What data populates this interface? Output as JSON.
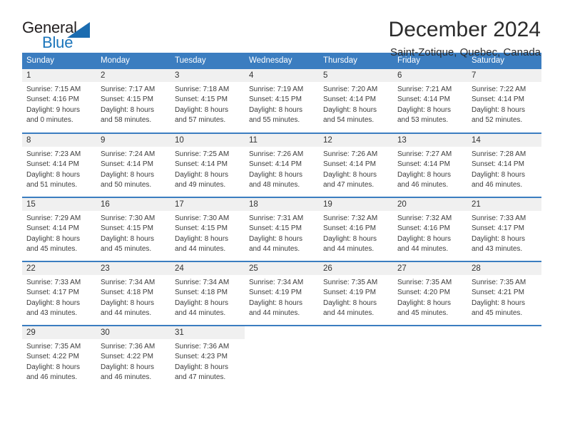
{
  "brand": {
    "name_top": "General",
    "name_bottom": "Blue",
    "accent_color": "#1b75bb",
    "triangle_color": "#1b6cb0"
  },
  "header": {
    "title": "December 2024",
    "location": "Saint-Zotique, Quebec, Canada"
  },
  "calendar": {
    "header_bg": "#3b7dc0",
    "daynum_bg": "#f0f0f0",
    "weekdays": [
      "Sunday",
      "Monday",
      "Tuesday",
      "Wednesday",
      "Thursday",
      "Friday",
      "Saturday"
    ],
    "weeks": [
      [
        {
          "day": "1",
          "sunrise": "Sunrise: 7:15 AM",
          "sunset": "Sunset: 4:16 PM",
          "daylight_1": "Daylight: 9 hours",
          "daylight_2": "and 0 minutes."
        },
        {
          "day": "2",
          "sunrise": "Sunrise: 7:17 AM",
          "sunset": "Sunset: 4:15 PM",
          "daylight_1": "Daylight: 8 hours",
          "daylight_2": "and 58 minutes."
        },
        {
          "day": "3",
          "sunrise": "Sunrise: 7:18 AM",
          "sunset": "Sunset: 4:15 PM",
          "daylight_1": "Daylight: 8 hours",
          "daylight_2": "and 57 minutes."
        },
        {
          "day": "4",
          "sunrise": "Sunrise: 7:19 AM",
          "sunset": "Sunset: 4:15 PM",
          "daylight_1": "Daylight: 8 hours",
          "daylight_2": "and 55 minutes."
        },
        {
          "day": "5",
          "sunrise": "Sunrise: 7:20 AM",
          "sunset": "Sunset: 4:14 PM",
          "daylight_1": "Daylight: 8 hours",
          "daylight_2": "and 54 minutes."
        },
        {
          "day": "6",
          "sunrise": "Sunrise: 7:21 AM",
          "sunset": "Sunset: 4:14 PM",
          "daylight_1": "Daylight: 8 hours",
          "daylight_2": "and 53 minutes."
        },
        {
          "day": "7",
          "sunrise": "Sunrise: 7:22 AM",
          "sunset": "Sunset: 4:14 PM",
          "daylight_1": "Daylight: 8 hours",
          "daylight_2": "and 52 minutes."
        }
      ],
      [
        {
          "day": "8",
          "sunrise": "Sunrise: 7:23 AM",
          "sunset": "Sunset: 4:14 PM",
          "daylight_1": "Daylight: 8 hours",
          "daylight_2": "and 51 minutes."
        },
        {
          "day": "9",
          "sunrise": "Sunrise: 7:24 AM",
          "sunset": "Sunset: 4:14 PM",
          "daylight_1": "Daylight: 8 hours",
          "daylight_2": "and 50 minutes."
        },
        {
          "day": "10",
          "sunrise": "Sunrise: 7:25 AM",
          "sunset": "Sunset: 4:14 PM",
          "daylight_1": "Daylight: 8 hours",
          "daylight_2": "and 49 minutes."
        },
        {
          "day": "11",
          "sunrise": "Sunrise: 7:26 AM",
          "sunset": "Sunset: 4:14 PM",
          "daylight_1": "Daylight: 8 hours",
          "daylight_2": "and 48 minutes."
        },
        {
          "day": "12",
          "sunrise": "Sunrise: 7:26 AM",
          "sunset": "Sunset: 4:14 PM",
          "daylight_1": "Daylight: 8 hours",
          "daylight_2": "and 47 minutes."
        },
        {
          "day": "13",
          "sunrise": "Sunrise: 7:27 AM",
          "sunset": "Sunset: 4:14 PM",
          "daylight_1": "Daylight: 8 hours",
          "daylight_2": "and 46 minutes."
        },
        {
          "day": "14",
          "sunrise": "Sunrise: 7:28 AM",
          "sunset": "Sunset: 4:14 PM",
          "daylight_1": "Daylight: 8 hours",
          "daylight_2": "and 46 minutes."
        }
      ],
      [
        {
          "day": "15",
          "sunrise": "Sunrise: 7:29 AM",
          "sunset": "Sunset: 4:14 PM",
          "daylight_1": "Daylight: 8 hours",
          "daylight_2": "and 45 minutes."
        },
        {
          "day": "16",
          "sunrise": "Sunrise: 7:30 AM",
          "sunset": "Sunset: 4:15 PM",
          "daylight_1": "Daylight: 8 hours",
          "daylight_2": "and 45 minutes."
        },
        {
          "day": "17",
          "sunrise": "Sunrise: 7:30 AM",
          "sunset": "Sunset: 4:15 PM",
          "daylight_1": "Daylight: 8 hours",
          "daylight_2": "and 44 minutes."
        },
        {
          "day": "18",
          "sunrise": "Sunrise: 7:31 AM",
          "sunset": "Sunset: 4:15 PM",
          "daylight_1": "Daylight: 8 hours",
          "daylight_2": "and 44 minutes."
        },
        {
          "day": "19",
          "sunrise": "Sunrise: 7:32 AM",
          "sunset": "Sunset: 4:16 PM",
          "daylight_1": "Daylight: 8 hours",
          "daylight_2": "and 44 minutes."
        },
        {
          "day": "20",
          "sunrise": "Sunrise: 7:32 AM",
          "sunset": "Sunset: 4:16 PM",
          "daylight_1": "Daylight: 8 hours",
          "daylight_2": "and 44 minutes."
        },
        {
          "day": "21",
          "sunrise": "Sunrise: 7:33 AM",
          "sunset": "Sunset: 4:17 PM",
          "daylight_1": "Daylight: 8 hours",
          "daylight_2": "and 43 minutes."
        }
      ],
      [
        {
          "day": "22",
          "sunrise": "Sunrise: 7:33 AM",
          "sunset": "Sunset: 4:17 PM",
          "daylight_1": "Daylight: 8 hours",
          "daylight_2": "and 43 minutes."
        },
        {
          "day": "23",
          "sunrise": "Sunrise: 7:34 AM",
          "sunset": "Sunset: 4:18 PM",
          "daylight_1": "Daylight: 8 hours",
          "daylight_2": "and 44 minutes."
        },
        {
          "day": "24",
          "sunrise": "Sunrise: 7:34 AM",
          "sunset": "Sunset: 4:18 PM",
          "daylight_1": "Daylight: 8 hours",
          "daylight_2": "and 44 minutes."
        },
        {
          "day": "25",
          "sunrise": "Sunrise: 7:34 AM",
          "sunset": "Sunset: 4:19 PM",
          "daylight_1": "Daylight: 8 hours",
          "daylight_2": "and 44 minutes."
        },
        {
          "day": "26",
          "sunrise": "Sunrise: 7:35 AM",
          "sunset": "Sunset: 4:19 PM",
          "daylight_1": "Daylight: 8 hours",
          "daylight_2": "and 44 minutes."
        },
        {
          "day": "27",
          "sunrise": "Sunrise: 7:35 AM",
          "sunset": "Sunset: 4:20 PM",
          "daylight_1": "Daylight: 8 hours",
          "daylight_2": "and 45 minutes."
        },
        {
          "day": "28",
          "sunrise": "Sunrise: 7:35 AM",
          "sunset": "Sunset: 4:21 PM",
          "daylight_1": "Daylight: 8 hours",
          "daylight_2": "and 45 minutes."
        }
      ],
      [
        {
          "day": "29",
          "sunrise": "Sunrise: 7:35 AM",
          "sunset": "Sunset: 4:22 PM",
          "daylight_1": "Daylight: 8 hours",
          "daylight_2": "and 46 minutes."
        },
        {
          "day": "30",
          "sunrise": "Sunrise: 7:36 AM",
          "sunset": "Sunset: 4:22 PM",
          "daylight_1": "Daylight: 8 hours",
          "daylight_2": "and 46 minutes."
        },
        {
          "day": "31",
          "sunrise": "Sunrise: 7:36 AM",
          "sunset": "Sunset: 4:23 PM",
          "daylight_1": "Daylight: 8 hours",
          "daylight_2": "and 47 minutes."
        },
        {
          "day": "",
          "sunrise": "",
          "sunset": "",
          "daylight_1": "",
          "daylight_2": ""
        },
        {
          "day": "",
          "sunrise": "",
          "sunset": "",
          "daylight_1": "",
          "daylight_2": ""
        },
        {
          "day": "",
          "sunrise": "",
          "sunset": "",
          "daylight_1": "",
          "daylight_2": ""
        },
        {
          "day": "",
          "sunrise": "",
          "sunset": "",
          "daylight_1": "",
          "daylight_2": ""
        }
      ]
    ]
  }
}
